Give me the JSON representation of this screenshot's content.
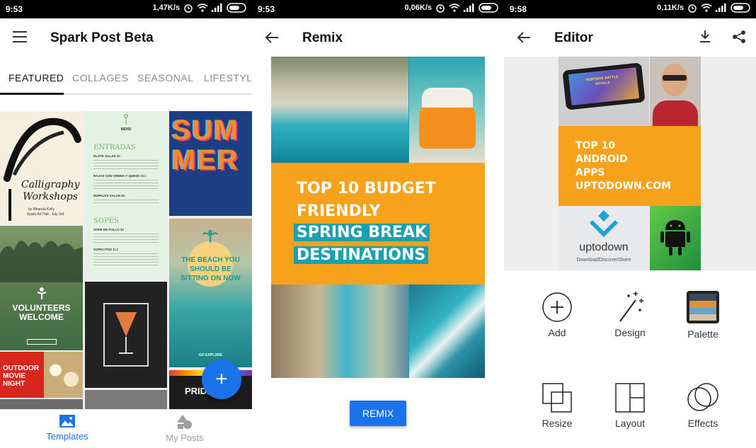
{
  "screens": [
    {
      "status": {
        "time": "9:53",
        "speed": "1,47K/s"
      },
      "appbar": {
        "title": "Spark Post Beta"
      },
      "tabs": [
        "FEATURED",
        "COLLAGES",
        "SEASONAL",
        "LIFESTYLE"
      ],
      "active_tab": "FEATURED",
      "templates": {
        "calligraphy": {
          "title": "Calligraphy Workshops",
          "byline": "by Miranda Kelly",
          "venue": "Spark Art Hall , July 3rd"
        },
        "menu": {
          "header": "MENU",
          "section1": "ENTRADAS",
          "items1": [
            {
              "name": "ELOTE SALAD",
              "price": "$6"
            },
            {
              "name": "RAJAS CON CREMA Y QUESO",
              "price": "$12"
            },
            {
              "name": "NOPALES SALAD",
              "price": "$8"
            }
          ],
          "section2": "SOPES",
          "items2": [
            {
              "name": "SOPE DE POLLO",
              "price": "$8"
            },
            {
              "name": "SOPECITOS",
              "price": "$12"
            }
          ]
        },
        "summer": {
          "title": "SUMMER"
        },
        "beach": {
          "text": "THE BEACH YOU SHOULD BE SITTING ON NOW",
          "cta": "GO EXPLORE"
        },
        "volunteers": {
          "title": "VOLUNTEERS WELCOME"
        },
        "movie": {
          "title": "OUTDOOR MOVIE NIGHT"
        },
        "pride": {
          "title": "PRIDE DAY"
        }
      },
      "bottomnav": {
        "templates": "Templates",
        "my_posts": "My Posts"
      },
      "fab": {
        "symbol": "+"
      }
    },
    {
      "status": {
        "time": "9:53",
        "speed": "0,06K/s"
      },
      "appbar": {
        "title": "Remix"
      },
      "poster": {
        "line1": "TOP 10 BUDGET",
        "line2": "FRIENDLY",
        "line3": "SPRING BREAK",
        "line4": "DESTINATIONS"
      },
      "remix_button": "REMIX"
    },
    {
      "status": {
        "time": "9:58",
        "speed": "0,11K/s"
      },
      "appbar": {
        "title": "Editor"
      },
      "poster": {
        "line1": "TOP 10",
        "line2": "ANDROID",
        "line3": "APPS",
        "line4": "UPTODOWN.COM",
        "game_title": "FORTNITE BATTLE ROYALE",
        "brand": "uptodown",
        "tagline": "DownloadDiscoverShare"
      },
      "tools": [
        "Add",
        "Design",
        "Palette",
        "Resize",
        "Layout",
        "Effects"
      ]
    }
  ],
  "colors": {
    "accent": "#1a73e8",
    "poster_orange": "#f7a21b",
    "poster_teal": "#1ba0b0",
    "status_bar": "#000000",
    "text_primary": "#111111",
    "text_secondary": "#8a8a8a"
  },
  "icons": {
    "menu": "hamburger-icon",
    "back": "arrow-back-icon",
    "download": "download-icon",
    "share": "share-icon",
    "templates": "image-icon",
    "my_posts": "shapes-icon"
  }
}
